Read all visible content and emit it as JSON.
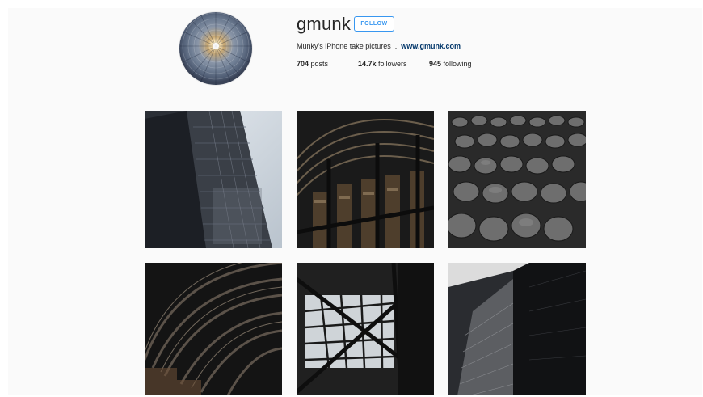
{
  "profile": {
    "username": "gmunk",
    "follow_label": "FOLLOW",
    "bio_text": "Munky's iPhone take pictures ...",
    "bio_link": "www.gmunk.com",
    "stats": {
      "posts_count": "704",
      "posts_label": "posts",
      "followers_count": "14.7k",
      "followers_label": "followers",
      "following_count": "945",
      "following_label": "following"
    }
  },
  "grid": {
    "tiles": [
      {
        "subject": "skyscraper-facade"
      },
      {
        "subject": "library-arched-shelves"
      },
      {
        "subject": "cobblestone-street"
      },
      {
        "subject": "barrel-vault-ceiling"
      },
      {
        "subject": "glass-roof-structure"
      },
      {
        "subject": "angular-glass-tower"
      }
    ]
  },
  "colors": {
    "accent": "#3897f0",
    "link": "#003569",
    "background": "#fafafa",
    "text": "#262626"
  }
}
